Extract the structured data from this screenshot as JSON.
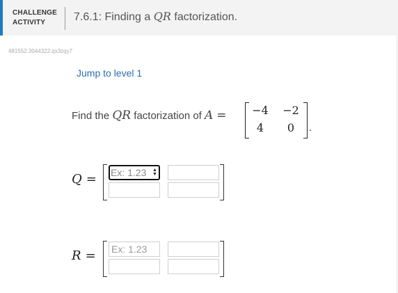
{
  "header": {
    "kicker_line1": "CHALLENGE",
    "kicker_line2": "ACTIVITY",
    "title_prefix": "7.6.1: Finding a ",
    "title_math": "QR",
    "title_suffix": " factorization."
  },
  "activity_code": "481552.3044322.qx3zqy7",
  "jump_link": "Jump to level 1",
  "prompt": {
    "prefix": "Find the ",
    "math_qr": "QR",
    "middle": " factorization of ",
    "math_a": "A",
    "equals": "=",
    "period": "."
  },
  "matrix_a": {
    "r1c1": "−4",
    "r1c2": "−2",
    "r2c1": "4",
    "r2c2": "0"
  },
  "q_label": "Q",
  "r_label": "R",
  "equals_sign": "=",
  "inputs": {
    "placeholder": "Ex: 1.23",
    "q11_value": "Ex: 1.23",
    "spin_up": "▲",
    "spin_down": "▼"
  },
  "colors": {
    "accent": "#1f7bc1",
    "link": "#2b6cb0"
  }
}
